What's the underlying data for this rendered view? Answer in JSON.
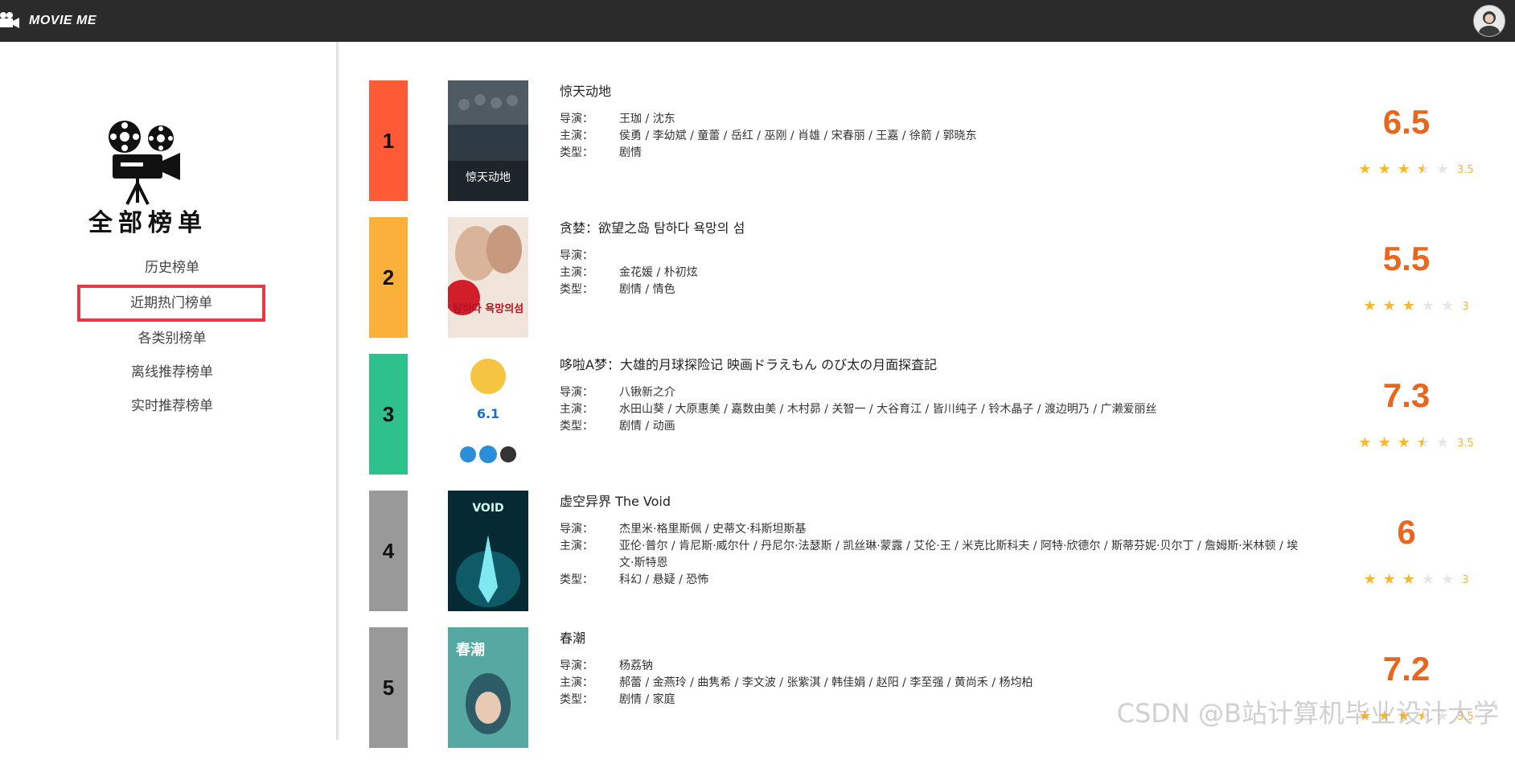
{
  "header": {
    "brand": "MOVIE ME"
  },
  "sidebar": {
    "title": "全部榜单",
    "menu": [
      "历史榜单",
      "近期热门榜单",
      "各类别榜单",
      "离线推荐榜单",
      "实时推荐榜单"
    ],
    "highlighted_index": 1
  },
  "labels": {
    "director": "导演：",
    "cast": "主演：",
    "genre": "类型："
  },
  "movies": [
    {
      "rank": "1",
      "rank_color": "#ff5a36",
      "title": "惊天动地",
      "director": "王珈 / 沈东",
      "cast": "侯勇 / 李幼斌 / 童蕾 / 岳红 / 巫刚 / 肖雄 / 宋春丽 / 王嘉 / 徐箭 / 郭晓东",
      "genre": "剧情",
      "score": "6.5",
      "stars": 3.5,
      "star_text": "3.5",
      "poster_text": "惊天动地"
    },
    {
      "rank": "2",
      "rank_color": "#fbb03b",
      "title": "贪婪：欲望之岛 탐하다 욕망의 섬",
      "director": "",
      "cast": "金花媛 / 朴初炫",
      "genre": "剧情 / 情色",
      "score": "5.5",
      "stars": 3,
      "star_text": "3",
      "poster_text": "탐하다 욕망의섬"
    },
    {
      "rank": "3",
      "rank_color": "#2ec08d",
      "title": "哆啦A梦：大雄的月球探险记 映画ドラえもん のび太の月面探査記",
      "director": "八锹新之介",
      "cast": "水田山葵 / 大原惠美 / 嘉数由美 / 木村昴 / 关智一 / 大谷育江 / 皆川纯子 / 铃木晶子 / 渡边明乃 / 广濑爱丽丝",
      "genre": "剧情 / 动画",
      "score": "7.3",
      "stars": 3.5,
      "star_text": "3.5",
      "poster_text": "6.1"
    },
    {
      "rank": "4",
      "rank_color": "#999999",
      "title": "虚空异界 The Void",
      "director": "杰里米·格里斯佩 / 史蒂文·科斯坦斯基",
      "cast": "亚伦·普尔 / 肯尼斯·威尔什 / 丹尼尔·法瑟斯 / 凯丝琳·蒙露 / 艾伦·王 / 米克比斯科夫 / 阿特·欣德尔 / 斯蒂芬妮·贝尔丁 / 詹姆斯·米林顿 / 埃文·斯特恩",
      "genre": "科幻 / 悬疑 / 恐怖",
      "score": "6",
      "stars": 3,
      "star_text": "3",
      "poster_text": "VOID"
    },
    {
      "rank": "5",
      "rank_color": "#999999",
      "title": "春潮",
      "director": "杨荔钠",
      "cast": "郝蕾 / 金燕玲 / 曲隽希 / 李文波 / 张紫淇 / 韩佳娟 / 赵阳 / 李至强 / 黄尚禾 / 杨均柏",
      "genre": "剧情 / 家庭",
      "score": "7.2",
      "stars": 3.5,
      "star_text": "3.5",
      "poster_text": "春潮"
    }
  ],
  "watermark": "CSDN @B站计算机毕业设计大学"
}
